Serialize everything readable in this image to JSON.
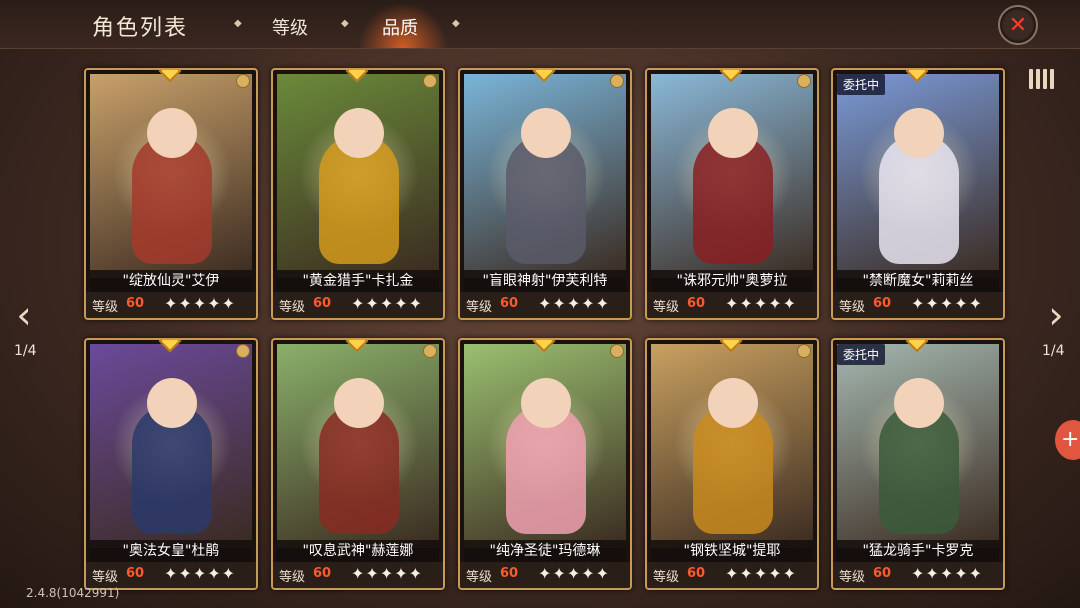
{
  "header": {
    "title": "角色列表",
    "tabs": [
      {
        "label": "等级",
        "active": false
      },
      {
        "label": "品质",
        "active": true
      }
    ]
  },
  "icons": {
    "close": "close-icon",
    "filter": "filter-icon",
    "prev": "chevron-left-icon",
    "next": "chevron-right-icon"
  },
  "pager": {
    "left": "1/4",
    "right": "1/4"
  },
  "version": "2.4.8(1042991)",
  "level_label": "等级",
  "colors": {
    "accent": "#ff5a2e",
    "frame": "#c99a55",
    "gem": "#ffd24a"
  },
  "cards": [
    {
      "name": "\"绽放仙灵\"艾伊",
      "level": "60",
      "stars": "✦✦✦✦✦",
      "badge": "",
      "bg": "#c8a06a",
      "fig": "#a43a2c"
    },
    {
      "name": "\"黄金猎手\"卡扎金",
      "level": "60",
      "stars": "✦✦✦✦✦",
      "badge": "",
      "bg": "#6a8a3a",
      "fig": "#d49a1c"
    },
    {
      "name": "\"盲眼神射\"伊芙利特",
      "level": "60",
      "stars": "✦✦✦✦✦",
      "badge": "",
      "bg": "#7ab4d8",
      "fig": "#5a5a6a"
    },
    {
      "name": "\"诛邪元帅\"奥萝拉",
      "level": "60",
      "stars": "✦✦✦✦✦",
      "badge": "",
      "bg": "#8ab8d8",
      "fig": "#8a1e22"
    },
    {
      "name": "\"禁断魔女\"莉莉丝",
      "level": "60",
      "stars": "✦✦✦✦✦",
      "badge": "委托中",
      "bg": "#7a9ad8",
      "fig": "#e8e4f0"
    },
    {
      "name": "\"奥法女皇\"杜鹃",
      "level": "60",
      "stars": "✦✦✦✦✦",
      "badge": "",
      "bg": "#6a4a9a",
      "fig": "#2a3a6a"
    },
    {
      "name": "\"叹息武神\"赫莲娜",
      "level": "60",
      "stars": "✦✦✦✦✦",
      "badge": "",
      "bg": "#8ab06a",
      "fig": "#8a2a22"
    },
    {
      "name": "\"纯净圣徒\"玛德琳",
      "level": "60",
      "stars": "✦✦✦✦✦",
      "badge": "",
      "bg": "#9ac070",
      "fig": "#f0a0b0"
    },
    {
      "name": "\"钢铁坚城\"提耶",
      "level": "60",
      "stars": "✦✦✦✦✦",
      "badge": "",
      "bg": "#c8a060",
      "fig": "#c88a1c"
    },
    {
      "name": "\"猛龙骑手\"卡罗克",
      "level": "60",
      "stars": "✦✦✦✦✦",
      "badge": "委托中",
      "bg": "#a4b8b0",
      "fig": "#3a5a3a"
    }
  ]
}
